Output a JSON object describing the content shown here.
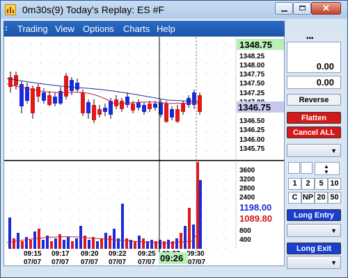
{
  "window": {
    "title": "0m30s(9) Today's Replay: ES #F",
    "close_glyph": "✕"
  },
  "menu": [
    {
      "label": "Trading"
    },
    {
      "label": "View"
    },
    {
      "label": "Options"
    },
    {
      "label": "Charts"
    },
    {
      "label": "Help"
    }
  ],
  "price_axis": {
    "last_price": "1348.75",
    "labels": [
      "1348.25",
      "1348.00",
      "1347.75",
      "1347.50",
      "1347.25",
      "1347.00",
      "1346.50",
      "1346.25",
      "1346.00",
      "1345.75"
    ],
    "current_price": "1346.75"
  },
  "volume_axis": {
    "labels": [
      "3600",
      "3200",
      "2800",
      "2400",
      "800",
      "400"
    ],
    "buy_volume": "1198.00",
    "sell_volume": "1089.80"
  },
  "time_axis": {
    "labels": [
      {
        "time": "09:15",
        "date": "07/07"
      },
      {
        "time": "09:17",
        "date": "07/07"
      },
      {
        "time": "09:20",
        "date": "07/07"
      },
      {
        "time": "09:22",
        "date": "07/07"
      },
      {
        "time": "09:25",
        "date": "07/07"
      },
      {
        "time": "09:27",
        "date": ""
      },
      {
        "time": "09:30",
        "date": "07/07"
      }
    ],
    "crosshair_time": "09:26"
  },
  "right_panel": {
    "dots": "•••",
    "value1": "0.00",
    "value2": "0.00",
    "reverse_label": "Reverse",
    "flatten_label": "Flatten",
    "cancel_all_label": "Cancel ALL",
    "qty_buttons": [
      "1",
      "2",
      "5",
      "10",
      "C",
      "NP",
      "20",
      "50"
    ],
    "long_entry_label": "Long Entry",
    "long_exit_label": "Long Exit"
  },
  "colors": {
    "up_bar": "#1a2ad8",
    "down_bar": "#e01818",
    "ma_fast": "#c0203a",
    "ma_slow": "#1a2a9a",
    "last_price_bg": "#b8f0b8",
    "current_price_bg": "#c8c8ee"
  }
}
